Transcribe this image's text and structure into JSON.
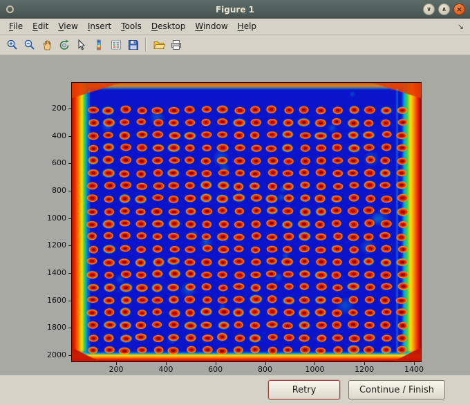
{
  "window": {
    "title": "Figure 1"
  },
  "titlebar": {
    "minimize_glyph": "∨",
    "maximize_glyph": "∧",
    "close_glyph": "×"
  },
  "menu": {
    "items": [
      {
        "label": "File",
        "mnemonic": "F"
      },
      {
        "label": "Edit",
        "mnemonic": "E"
      },
      {
        "label": "View",
        "mnemonic": "V"
      },
      {
        "label": "Insert",
        "mnemonic": "I"
      },
      {
        "label": "Tools",
        "mnemonic": "T"
      },
      {
        "label": "Desktop",
        "mnemonic": "D"
      },
      {
        "label": "Window",
        "mnemonic": "W"
      },
      {
        "label": "Help",
        "mnemonic": "H"
      }
    ],
    "dock_glyph": "↘"
  },
  "toolbar": {
    "buttons": [
      "zoom-in",
      "zoom-out",
      "pan",
      "rotate-3d",
      "data-cursor",
      "insert-colorbar",
      "insert-legend",
      "save-figure",
      "open-file",
      "print-figure"
    ]
  },
  "plot": {
    "type": "heatmap",
    "description": "Microarray plate scan image displayed with jet colormap: deep blue field, regular grid of red/orange spots with yellow-green halos, saturated red/orange borders on image edges",
    "x_ticks": [
      200,
      400,
      600,
      800,
      1000,
      1200,
      1400
    ],
    "y_ticks": [
      200,
      400,
      600,
      800,
      1000,
      1200,
      1400,
      1600,
      1800,
      2000
    ],
    "x_range": [
      1,
      1450
    ],
    "y_range": [
      1,
      2048
    ],
    "spot_grid": {
      "rows": 20,
      "cols": 20
    },
    "colors": {
      "background": "#0a15cb",
      "spot_core": "#8a0200",
      "spot_body": "#f02800",
      "spot_ring": "#ff9500",
      "halo_green": "rgba(40,235,180,0.55)",
      "halo_lime": "rgba(130,255,80,0.35)",
      "edge_red": "#b50c00",
      "edge_orange": "#ff8e00",
      "edge_yellow": "#ffe400",
      "edge_green": "#35cf55",
      "edge_cyan": "#00aae0"
    }
  },
  "buttons": {
    "retry": "Retry",
    "continue_finish": "Continue / Finish"
  },
  "colors": {
    "titlebar_bg": "#47524f",
    "titlebar_bg_light": "#5d6c6a",
    "titlebar_text": "#e9e4d2",
    "chrome_bg": "#d6d2c8",
    "figure_bg": "#a8a9a2",
    "close_button": "#d04c08",
    "button_border_focus": "#9a4038"
  }
}
